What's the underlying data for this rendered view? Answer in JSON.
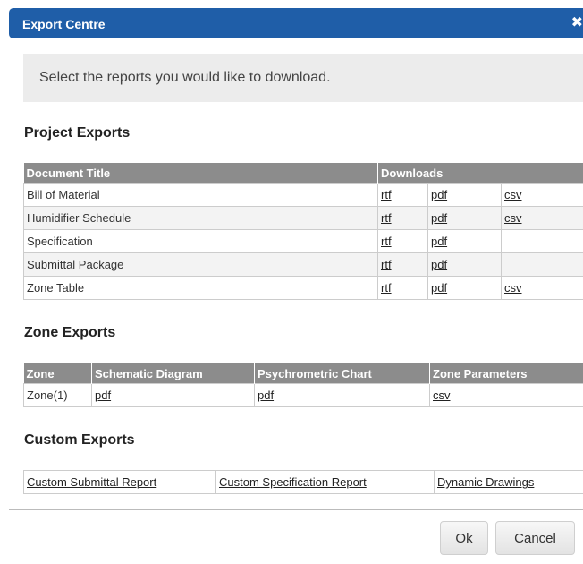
{
  "dialog": {
    "title": "Export Centre",
    "close_glyph": "✖",
    "close_icon": "close-icon",
    "intro": "Select the reports you would like to download."
  },
  "project_exports": {
    "title": "Project Exports",
    "headers": {
      "document_title": "Document Title",
      "downloads": "Downloads"
    },
    "rows": [
      {
        "title": "Bill of Material",
        "rtf": "rtf",
        "pdf": "pdf",
        "csv": "csv"
      },
      {
        "title": "Humidifier Schedule",
        "rtf": "rtf",
        "pdf": "pdf",
        "csv": "csv"
      },
      {
        "title": "Specification",
        "rtf": "rtf",
        "pdf": "pdf",
        "csv": ""
      },
      {
        "title": "Submittal Package",
        "rtf": "rtf",
        "pdf": "pdf",
        "csv": ""
      },
      {
        "title": "Zone Table",
        "rtf": "rtf",
        "pdf": "pdf",
        "csv": "csv"
      }
    ]
  },
  "zone_exports": {
    "title": "Zone Exports",
    "headers": [
      "Zone",
      "Schematic Diagram",
      "Psychrometric Chart",
      "Zone Parameters"
    ],
    "rows": [
      {
        "zone": "Zone(1)",
        "schematic": "pdf",
        "psychrometric": "pdf",
        "parameters": "csv"
      }
    ]
  },
  "custom_exports": {
    "title": "Custom Exports",
    "links": [
      "Custom Submittal Report",
      "Custom Specification Report",
      "Dynamic Drawings"
    ]
  },
  "buttons": {
    "ok": "Ok",
    "cancel": "Cancel"
  },
  "colors": {
    "titlebar": "#1f5ea8",
    "header_bg": "#8c8c8c",
    "intro_bg": "#ececec"
  }
}
